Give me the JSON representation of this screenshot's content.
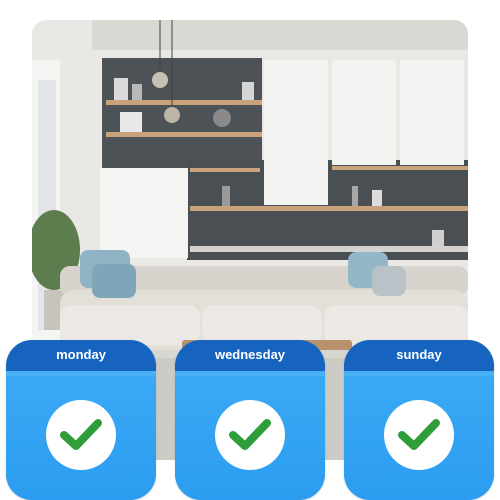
{
  "photo": {
    "subject": "modern-living-room"
  },
  "days": [
    {
      "label": "monday",
      "checked": true
    },
    {
      "label": "wednesday",
      "checked": true
    },
    {
      "label": "sunday",
      "checked": true
    }
  ],
  "colors": {
    "header_blue": "#1764c0",
    "body_blue": "#3aa9f5",
    "check_green": "#2e9d3a"
  }
}
